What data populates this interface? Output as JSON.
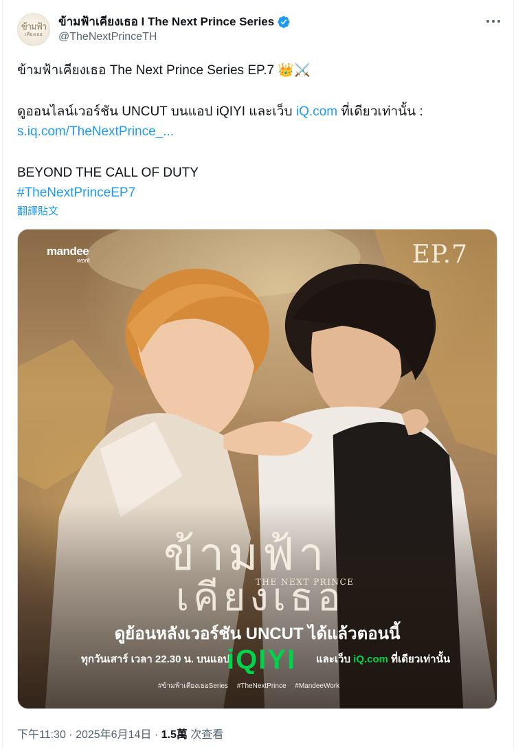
{
  "author": {
    "display_name": "ข้ามฟ้าเคียงเธอ I The Next Prince Series",
    "handle": "@TheNextPrinceTH",
    "verified": true,
    "avatar_text_top": "ข้ามฟ้า",
    "avatar_text_bottom": "เคียงเธอ"
  },
  "icons": {
    "verified": "verified-badge-icon",
    "more": "more-options-icon"
  },
  "tweet": {
    "line1": "ข้ามฟ้าเคียงเธอ The Next Prince Series EP.7 👑⚔️",
    "line2_prefix": "ดูออนไลน์เวอร์ชัน UNCUT บนแอป iQIYI และเว็บ ",
    "line2_link": "iQ.com",
    "line2_suffix": " ที่เดียวเท่านั้น :",
    "link_url": "s.iq.com/TheNextPrince_...",
    "line4": "BEYOND THE CALL OF DUTY",
    "hashtag": "#TheNextPrinceEP7",
    "translate": "翻譯貼文"
  },
  "media": {
    "logo": "mandee",
    "logo_sub": "work",
    "episode": "EP.7",
    "title_main": "ข้ามฟ้า",
    "title_sub": "เคียงเธอ",
    "title_en": "THE NEXT PRINCE",
    "cta": "ดูย้อนหลังเวอร์ชัน UNCUT ได้แล้วตอนนี้",
    "schedule": "ทุกวันเสาร์ เวลา 22.30 น. บนแอป",
    "brand": "iQIYI",
    "web_prefix": "และเว็บ ",
    "web_link": "iQ.com",
    "web_suffix": " ที่เดียวเท่านั้น",
    "hashtags": "#ข้ามฟ้าเคียงเธอSeries #TheNextPrince #MandeeWork"
  },
  "meta": {
    "time": "下午11:30",
    "separator": " · ",
    "date": "2025年6月14日",
    "views_count": "1.5萬",
    "views_label": " 次查看"
  },
  "colors": {
    "link": "#1d9bf0",
    "text": "#0f1419",
    "secondary": "#536471",
    "iqiyi_green": "#00d34b"
  }
}
